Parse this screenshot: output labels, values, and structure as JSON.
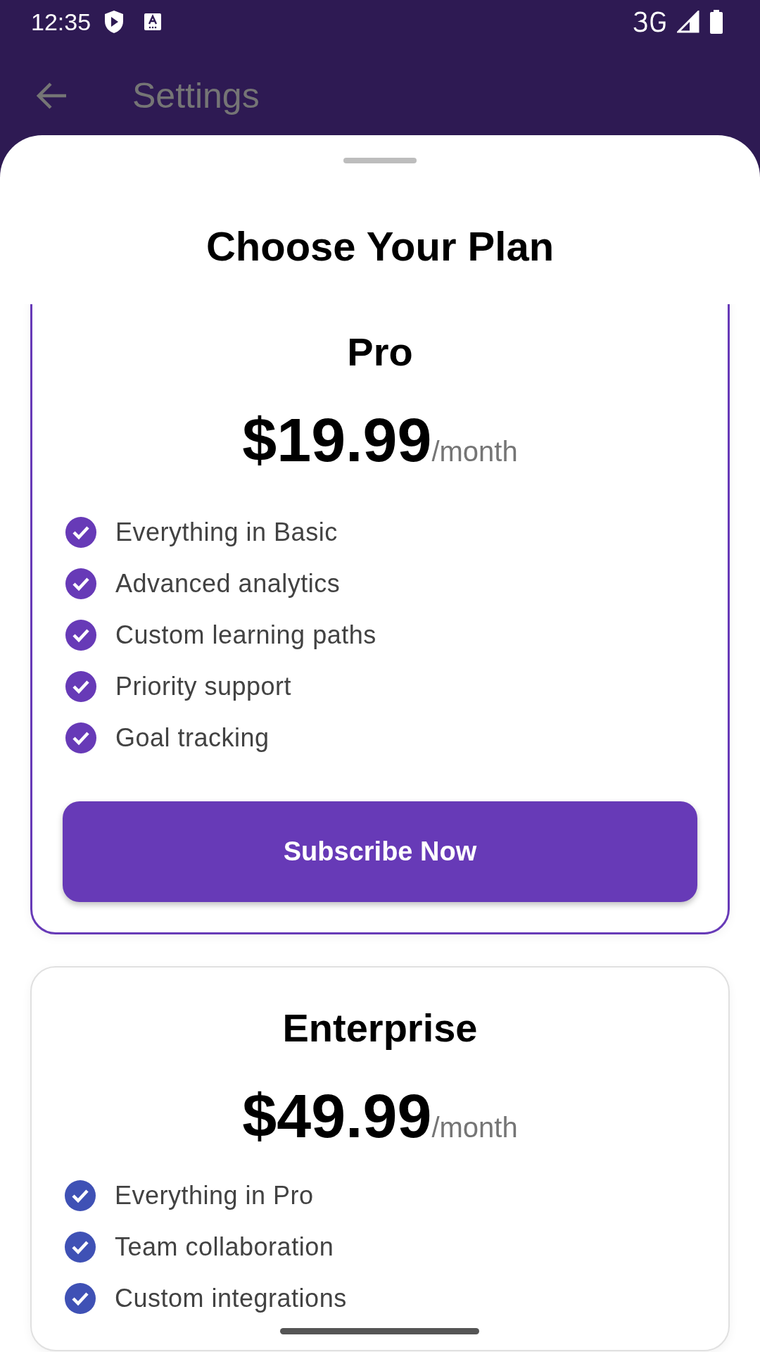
{
  "status_bar": {
    "time": "12:35"
  },
  "app_bar": {
    "title": "Settings"
  },
  "sheet": {
    "title": "Choose Your Plan"
  },
  "plans": [
    {
      "name": "Pro",
      "price": "$19.99",
      "period": "/month",
      "highlighted": true,
      "color": "#673ab7",
      "features": [
        "Everything in Basic",
        "Advanced analytics",
        "Custom learning paths",
        "Priority support",
        "Goal tracking"
      ],
      "button": "Subscribe Now"
    },
    {
      "name": "Enterprise",
      "price": "$49.99",
      "period": "/month",
      "highlighted": false,
      "color": "#3f51b5",
      "features": [
        "Everything in Pro",
        "Team collaboration",
        "Custom integrations"
      ]
    }
  ]
}
